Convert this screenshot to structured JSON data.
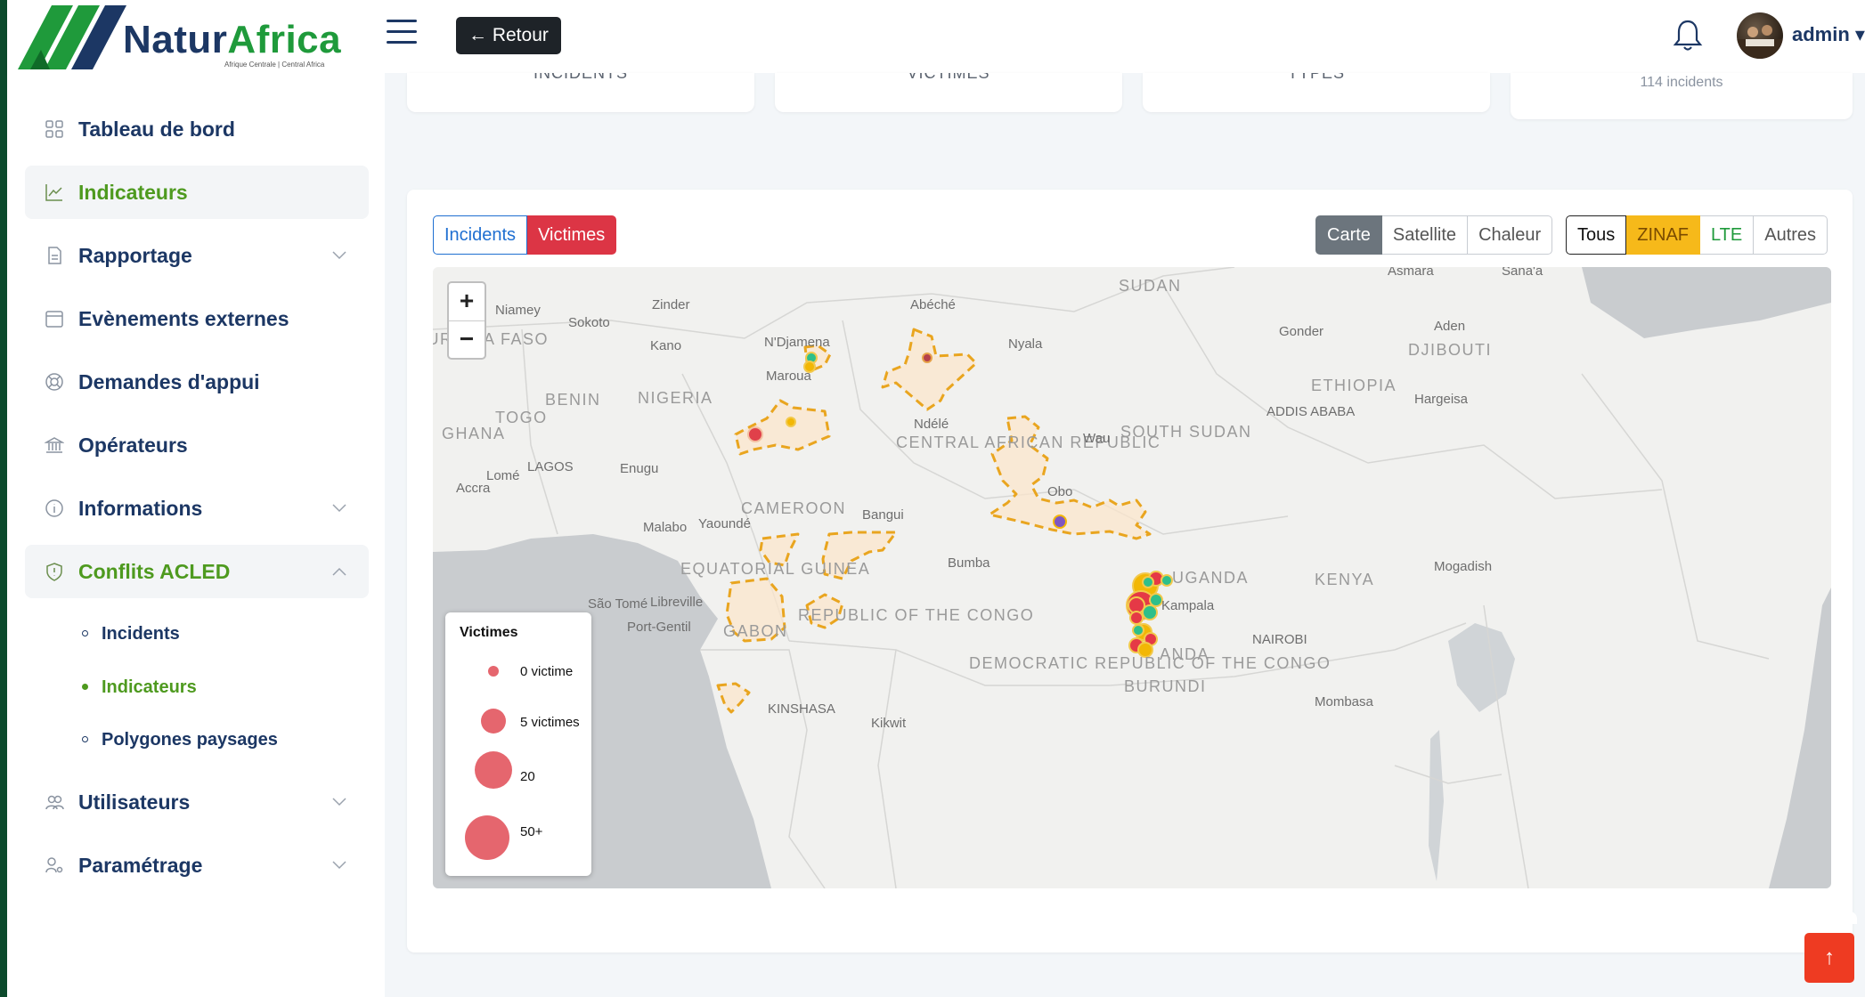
{
  "brand": {
    "name_part1": "Natur",
    "name_part2": "Africa",
    "tagline": "Afrique Centrale | Central Africa",
    "dark_color": "#1c3764",
    "green_color": "#1f9a3b"
  },
  "header": {
    "back_label": "← Retour",
    "user_name": "admin ▾",
    "notification_icon": "bell-icon"
  },
  "sidebar": {
    "items": [
      {
        "label": "Tableau de bord",
        "icon": "dashboard-icon"
      },
      {
        "label": "Indicateurs",
        "icon": "line-chart-icon"
      },
      {
        "label": "Rapportage",
        "icon": "document-icon"
      },
      {
        "label": "Evènements externes",
        "icon": "calendar-icon"
      },
      {
        "label": "Demandes d'appui",
        "icon": "lifebuoy-icon"
      },
      {
        "label": "Opérateurs",
        "icon": "bank-icon"
      },
      {
        "label": "Informations",
        "icon": "info-icon"
      },
      {
        "label": "Conflits ACLED",
        "icon": "shield-icon"
      },
      {
        "label": "Utilisateurs",
        "icon": "users-icon"
      },
      {
        "label": "Paramétrage",
        "icon": "settings-icon"
      }
    ],
    "acled_sub_items": [
      {
        "label": "Incidents"
      },
      {
        "label": "Indicateurs"
      },
      {
        "label": "Polygones paysages"
      }
    ],
    "active_color": "#4e9a1f"
  },
  "stats": {
    "cards": [
      {
        "label": "INCIDENTS"
      },
      {
        "label": "VICTIMES"
      },
      {
        "label": "TYPES"
      },
      {
        "label": "",
        "sub": "114 incidents"
      }
    ]
  },
  "map": {
    "metric_toggle": [
      "Incidents",
      "Victimes"
    ],
    "metric_selected": "Victimes",
    "metric_selected_color": "#dc3545",
    "layer_toggle": [
      "Carte",
      "Satellite",
      "Chaleur"
    ],
    "layer_selected": "Carte",
    "filter_toggle": [
      "Tous",
      "ZINAF",
      "LTE",
      "Autres"
    ],
    "filter_zinaf_color": "#f6b91a",
    "filter_lte_color": "#1f9a3b",
    "zoom_in": "+",
    "zoom_out": "−",
    "legend": {
      "title": "Victimes",
      "entries": [
        "0 victime",
        "5 victimes",
        "20",
        "50+"
      ],
      "color": "#e04b55"
    },
    "labels": {
      "niamey": "Niamey",
      "zinder": "Zinder",
      "sokoto": "Sokoto",
      "abeche": "Abéché",
      "sudan": "SUDAN",
      "asmara": "Asmara",
      "sanaa": "Sana'a",
      "burkina": "BURKINA FASO",
      "kano": "Kano",
      "ndjamena": "N'Djamena",
      "nyala": "Nyala",
      "gonder": "Gonder",
      "aden": "Aden",
      "djibouti": "DJIBOUTI",
      "maroua": "Maroua",
      "ethiopia": "ETHIOPIA",
      "hargeisa": "Hargeisa",
      "benin": "BENIN",
      "nigeria": "NIGERIA",
      "togo": "TOGO",
      "addis": "ADDIS ABABA",
      "ghana": "GHANA",
      "ndele": "Ndélé",
      "car": "CENTRAL AFRICAN REPUBLIC",
      "wau": "Wau",
      "southsudan": "SOUTH SUDAN",
      "lagos": "LAGOS",
      "enugu": "Enugu",
      "lome": "Lomé",
      "accra": "Accra",
      "obo": "Obo",
      "cameroon": "CAMEROON",
      "bangui": "Bangui",
      "malabo": "Malabo",
      "yaounde": "Yaoundé",
      "mogadishu": "Mogadish",
      "eqguinea": "EQUATORIAL GUINEA",
      "bumba": "Bumba",
      "uganda": "UGANDA",
      "kenya": "KENYA",
      "saotome": "São Tomé",
      "libreville": "Libreville",
      "kampala": "Kampala",
      "portgentil": "Port-Gentil",
      "gabon": "GABON",
      "congo": "REPUBLIC OF THE CONGO",
      "nairobi": "NAIROBI",
      "rwanda": "ANDA",
      "drc": "DEMOCRATIC REPUBLIC OF THE CONGO",
      "burundi": "BURUNDI",
      "mombasa": "Mombasa",
      "kinshasa": "KINSHASA",
      "kikwit": "Kikwit"
    }
  },
  "scroll_top_icon": "↑"
}
